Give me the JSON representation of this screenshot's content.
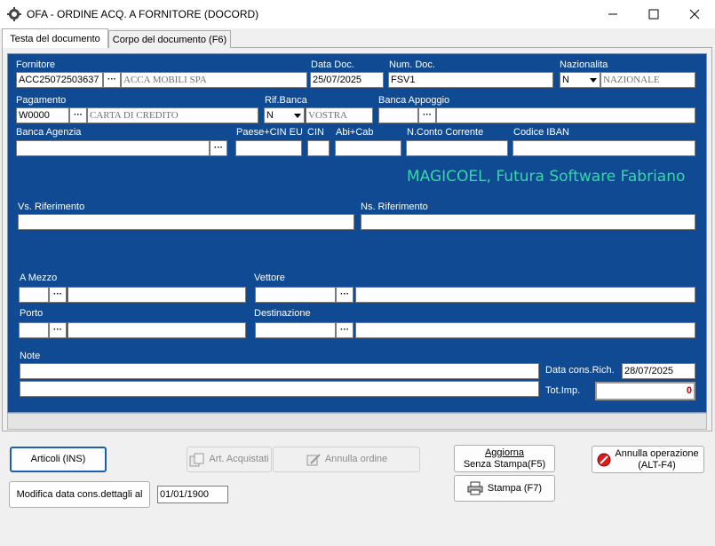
{
  "window": {
    "title": "OFA - ORDINE ACQ. A FORNITORE (DOCORD)",
    "min_glyph": "—",
    "max_glyph": "☐",
    "close_glyph": "✕"
  },
  "tabs": [
    {
      "label": "Testa del documento",
      "active": true
    },
    {
      "label": "Corpo del documento (F6)",
      "active": false
    }
  ],
  "form": {
    "fornitore": {
      "label": "Fornitore",
      "code": "ACC25072503637",
      "name": "ACCA MOBILI SPA"
    },
    "data_doc": {
      "label": "Data Doc.",
      "value": "25/07/2025"
    },
    "num_doc": {
      "label": "Num. Doc.",
      "value": "FSV1"
    },
    "nazionalita": {
      "label": "Nazionalita",
      "selected": "N",
      "desc": "NAZIONALE"
    },
    "pagamento": {
      "label": "Pagamento",
      "code": "W0000",
      "desc": "CARTA DI CREDITO"
    },
    "rif_banca": {
      "label": "Rif.Banca",
      "selected": "N",
      "desc": "VOSTRA"
    },
    "banca_appoggio": {
      "label": "Banca Appoggio",
      "code": "",
      "desc": ""
    },
    "banca_agenzia": {
      "label": "Banca Agenzia",
      "value": ""
    },
    "paese_cin": {
      "label": "Paese+CIN EU",
      "value": ""
    },
    "cin": {
      "label": "CIN",
      "value": ""
    },
    "abi_cab": {
      "label": "Abi+Cab",
      "value": ""
    },
    "conto": {
      "label": "N.Conto Corrente",
      "value": ""
    },
    "iban": {
      "label": "Codice IBAN",
      "value": ""
    },
    "watermark": "MAGICOEL, Futura Software Fabriano",
    "vs_rif": {
      "label": "Vs. Riferimento",
      "value": ""
    },
    "ns_rif": {
      "label": "Ns. Riferimento",
      "value": ""
    },
    "a_mezzo": {
      "label": "A Mezzo",
      "code": "",
      "desc": ""
    },
    "vettore": {
      "label": "Vettore",
      "code": "",
      "desc": ""
    },
    "porto": {
      "label": "Porto",
      "code": "",
      "desc": ""
    },
    "destinazione": {
      "label": "Destinazione",
      "code": "",
      "desc": ""
    },
    "note": {
      "label": "Note",
      "line1": "",
      "line2": ""
    },
    "data_cons": {
      "label": "Data cons.Rich.",
      "value": "28/07/2025"
    },
    "tot_imp": {
      "label": "Tot.Imp.",
      "value": "0"
    },
    "dots": "···"
  },
  "buttons": {
    "articoli": "Articoli  (INS)",
    "art_acquistati": "Art. Acquistati",
    "annulla_ordine": "Annulla ordine",
    "aggiorna_line1": "Aggiorna",
    "aggiorna_line2": "Senza Stampa(F5)",
    "stampa": "Stampa  (F7)",
    "annulla_op_line1": "Annulla operazione",
    "annulla_op_line2": "(ALT-F4)",
    "modifica_data": "Modifica data cons.dettagli al"
  },
  "modifica_data_value": "01/01/1900",
  "colors": {
    "panel": "#0f4a93",
    "accent_text": "#38d6a9",
    "total_red": "#d00000"
  }
}
